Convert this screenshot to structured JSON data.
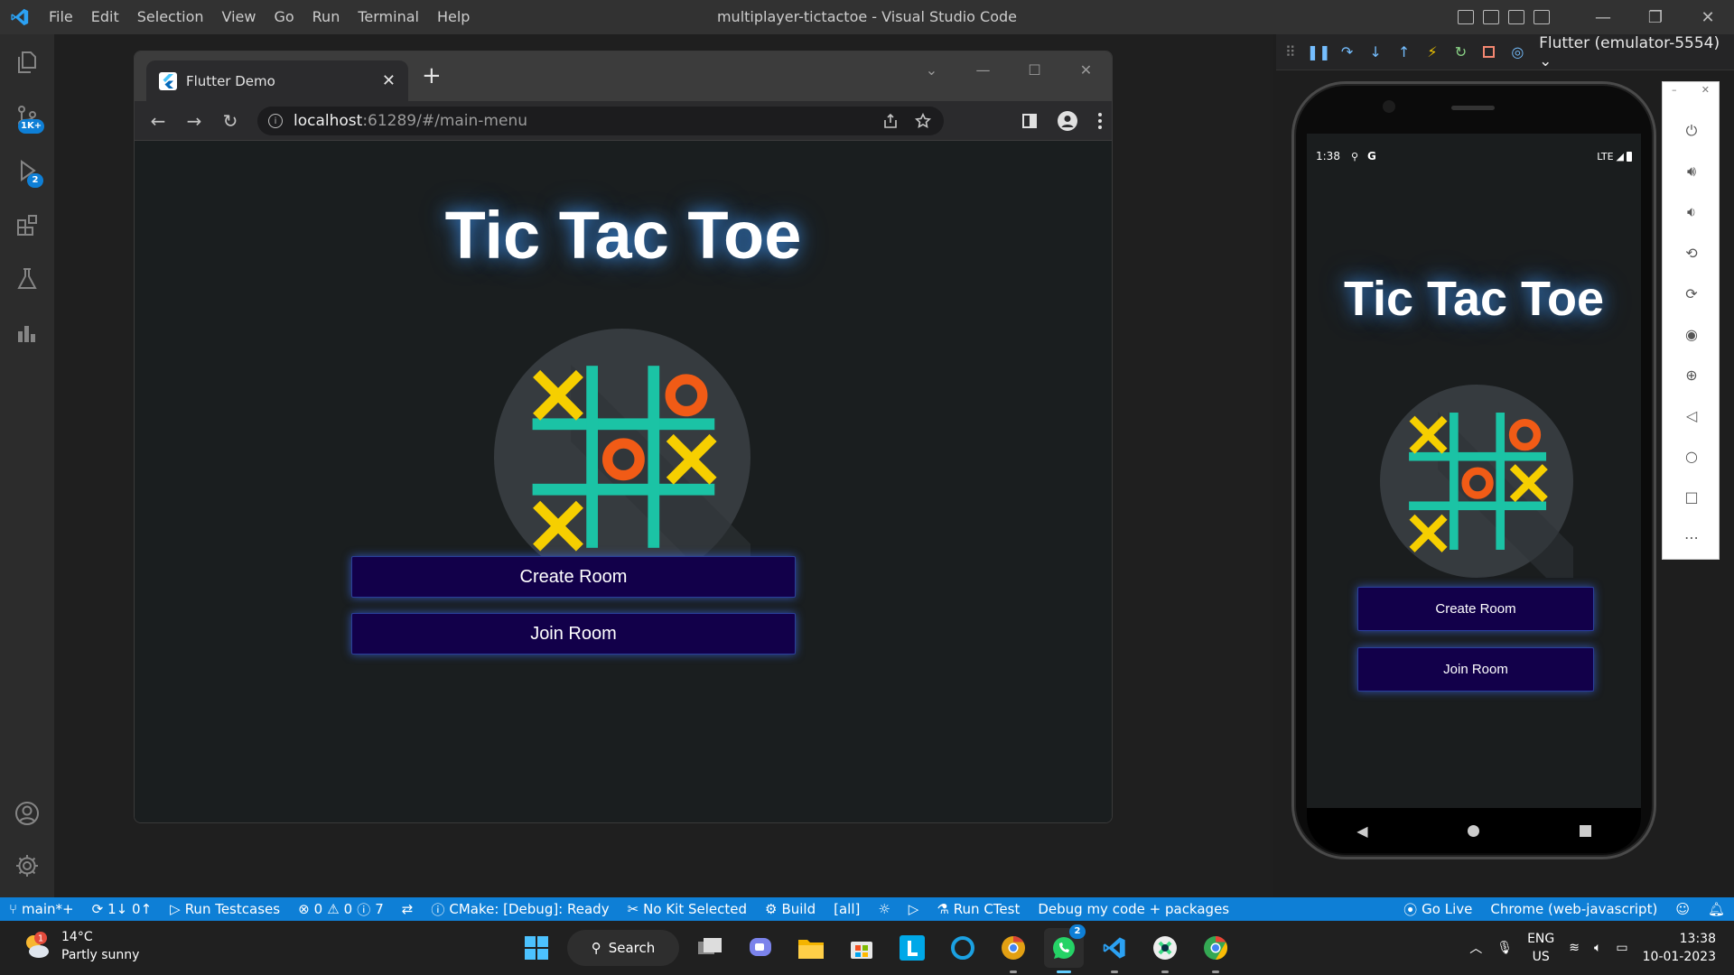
{
  "vscode": {
    "menu": [
      "File",
      "Edit",
      "Selection",
      "View",
      "Go",
      "Run",
      "Terminal",
      "Help"
    ],
    "window_title": "multiplayer-tictactoe - Visual Studio Code",
    "activity_badges": {
      "source_control": "1K+",
      "run_debug": "2"
    }
  },
  "browser": {
    "tab_title": "Flutter Demo",
    "url_host": "localhost",
    "url_path": ":61289/#/main-menu"
  },
  "app": {
    "title": "Tic Tac Toe",
    "create_room_label": "Create Room",
    "join_room_label": "Join Room",
    "colors": {
      "x": "#f6cf00",
      "o": "#f15b16",
      "grid": "#1bc3a5",
      "board_circle": "#363b3f",
      "button_bg": "#12004a"
    }
  },
  "emulator": {
    "device": "Flutter (emulator-5554)",
    "status_time": "1:38",
    "status_network": "LTE"
  },
  "statusbar": {
    "branch": "main*+",
    "sync": "1↓ 0↑",
    "run_testcases": "Run Testcases",
    "errors": "0",
    "warnings": "0",
    "infos": "7",
    "cmake": "CMake: [Debug]: Ready",
    "kit": "No Kit Selected",
    "build": "Build",
    "target": "[all]",
    "run_ctest": "Run CTest",
    "debug_mode": "Debug my code + packages",
    "go_live": "Go Live",
    "debug_target": "Chrome (web-javascript)"
  },
  "taskbar": {
    "temperature": "14°C",
    "weather": "Partly sunny",
    "weather_badge": "1",
    "search_label": "Search",
    "whatsapp_badge": "2",
    "lang": "ENG",
    "region": "US",
    "time": "13:38",
    "date": "10-01-2023"
  }
}
